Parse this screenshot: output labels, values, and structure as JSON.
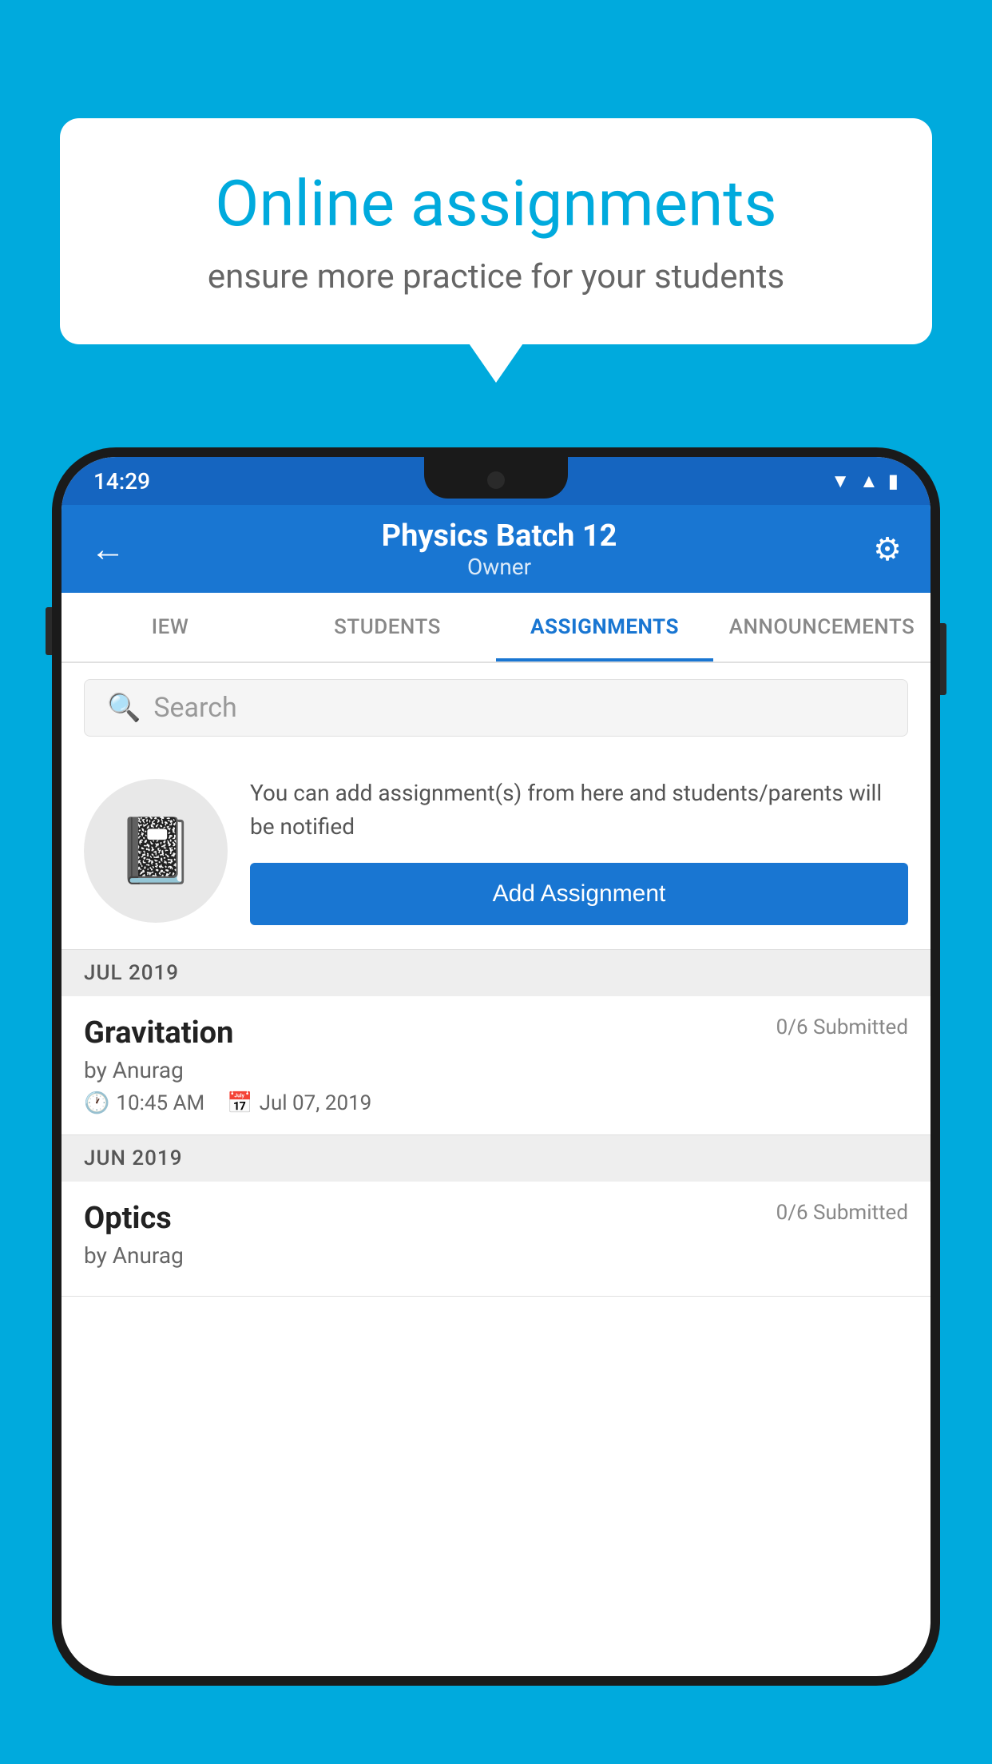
{
  "background_color": "#00AADD",
  "speech_bubble": {
    "title": "Online assignments",
    "subtitle": "ensure more practice for your students"
  },
  "status_bar": {
    "time": "14:29",
    "icons": [
      "wifi",
      "signal",
      "battery"
    ]
  },
  "app_header": {
    "title": "Physics Batch 12",
    "subtitle": "Owner",
    "back_label": "←",
    "settings_label": "⚙"
  },
  "tabs": [
    {
      "label": "IEW",
      "active": false
    },
    {
      "label": "STUDENTS",
      "active": false
    },
    {
      "label": "ASSIGNMENTS",
      "active": true
    },
    {
      "label": "ANNOUNCEMENTS",
      "active": false
    }
  ],
  "search": {
    "placeholder": "Search"
  },
  "promo": {
    "description": "You can add assignment(s) from here and students/parents will be notified",
    "add_button_label": "Add Assignment"
  },
  "sections": [
    {
      "label": "JUL 2019",
      "assignments": [
        {
          "title": "Gravitation",
          "submitted": "0/6 Submitted",
          "author": "by Anurag",
          "time": "10:45 AM",
          "date": "Jul 07, 2019"
        }
      ]
    },
    {
      "label": "JUN 2019",
      "assignments": [
        {
          "title": "Optics",
          "submitted": "0/6 Submitted",
          "author": "by Anurag",
          "time": "",
          "date": ""
        }
      ]
    }
  ]
}
